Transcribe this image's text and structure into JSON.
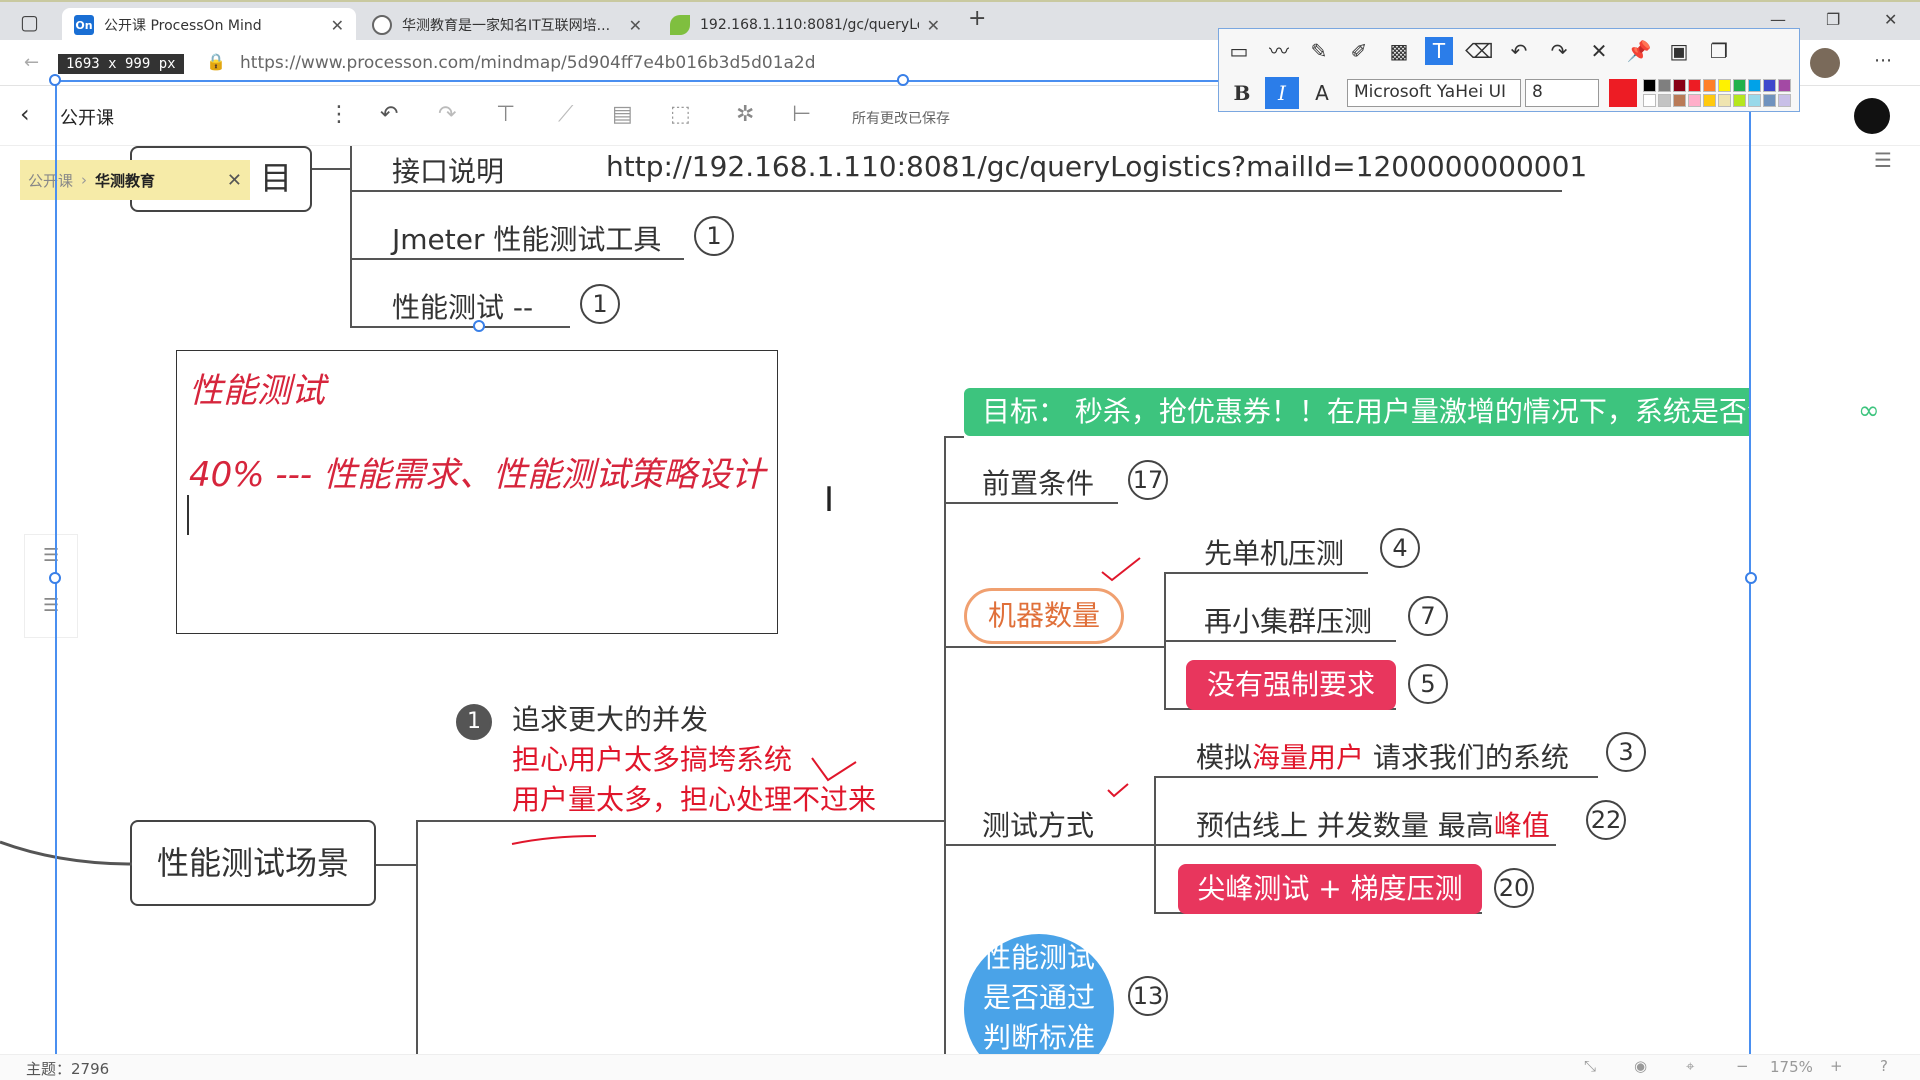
{
  "browser": {
    "tabs": [
      {
        "label": "公开课 ProcessOn Mind",
        "icon": "On"
      },
      {
        "label": "华测教育是一家知名IT互联网培...",
        "icon": "globe-icon"
      },
      {
        "label": "192.168.1.110:8081/gc/queryLo...",
        "icon": "leaf-icon"
      }
    ],
    "new_tab": "+",
    "url": "https://www.processon.com/mindmap/5d904ff7e4b016b3d5d01a2d",
    "dimension_badge": "1693 x 999  px",
    "window_controls": [
      "—",
      "❐",
      "✕"
    ]
  },
  "app": {
    "doc_title": "公开课",
    "saved_status": "所有更改已保存",
    "breadcrumb": [
      "公开课",
      "华测教育"
    ]
  },
  "annotation_toolbar": {
    "font": "Microsoft YaHei UI",
    "size": "8",
    "bold": "B",
    "italic": "I",
    "font_icon": "A",
    "colors": [
      "#000000",
      "#7f7f7f",
      "#880015",
      "#ed1c24",
      "#ff7f27",
      "#fff200",
      "#22b14c",
      "#00a2e8",
      "#3f48cc",
      "#a349a4",
      "#ffffff",
      "#c3c3c3",
      "#b97a57",
      "#ffaec9",
      "#ffc90e",
      "#efe4b0",
      "#b5e61d",
      "#99d9ea",
      "#7092be",
      "#c8bfe7"
    ],
    "selected_color": "#ed1c24"
  },
  "mindmap": {
    "root_partial": "目",
    "interface_label": "接口说明",
    "interface_url": "http://192.168.1.110:8081/gc/queryLogistics?mailId=1200000000001",
    "jmeter": "Jmeter 性能测试工具",
    "jmeter_count": "1",
    "perf_test_node": "性能测试 --",
    "perf_test_count": "1",
    "scene": "性能测试场景",
    "pursue_num": "1",
    "pursue": "追求更大的并发",
    "worry1": "担心用户太多搞垮系统",
    "worry2": "用户量太多，担心处理不过来",
    "goal": "目标： 秒杀，抢优惠券！！在用户量激增的情况下，系统是否会崩溃",
    "precondition": "前置条件",
    "precondition_count": "17",
    "machines": "机器数量",
    "single_machine": "先单机压测",
    "single_machine_count": "4",
    "small_cluster": "再小集群压测",
    "small_cluster_count": "7",
    "no_requirement": "没有强制要求",
    "no_requirement_count": "5",
    "test_method": "测试方式",
    "simulate_prefix": "模拟",
    "simulate_red": "海量用户",
    "simulate_suffix": " 请求我们的系统",
    "simulate_count": "3",
    "estimate_prefix": "预估线上 并发数量 最高",
    "estimate_red": "峰值",
    "estimate_count": "22",
    "peak_test": "尖峰测试 + 梯度压测",
    "peak_test_count": "20",
    "pass_line1": "性能测试",
    "pass_line2": "是否通过",
    "pass_line3": "判断标准",
    "pass_count": "13"
  },
  "textbox": {
    "line1": "性能测试",
    "line2": "40% --- 性能需求、性能测试策略设计"
  },
  "status": {
    "topic_count": "主题：2796",
    "zoom": "175%"
  }
}
